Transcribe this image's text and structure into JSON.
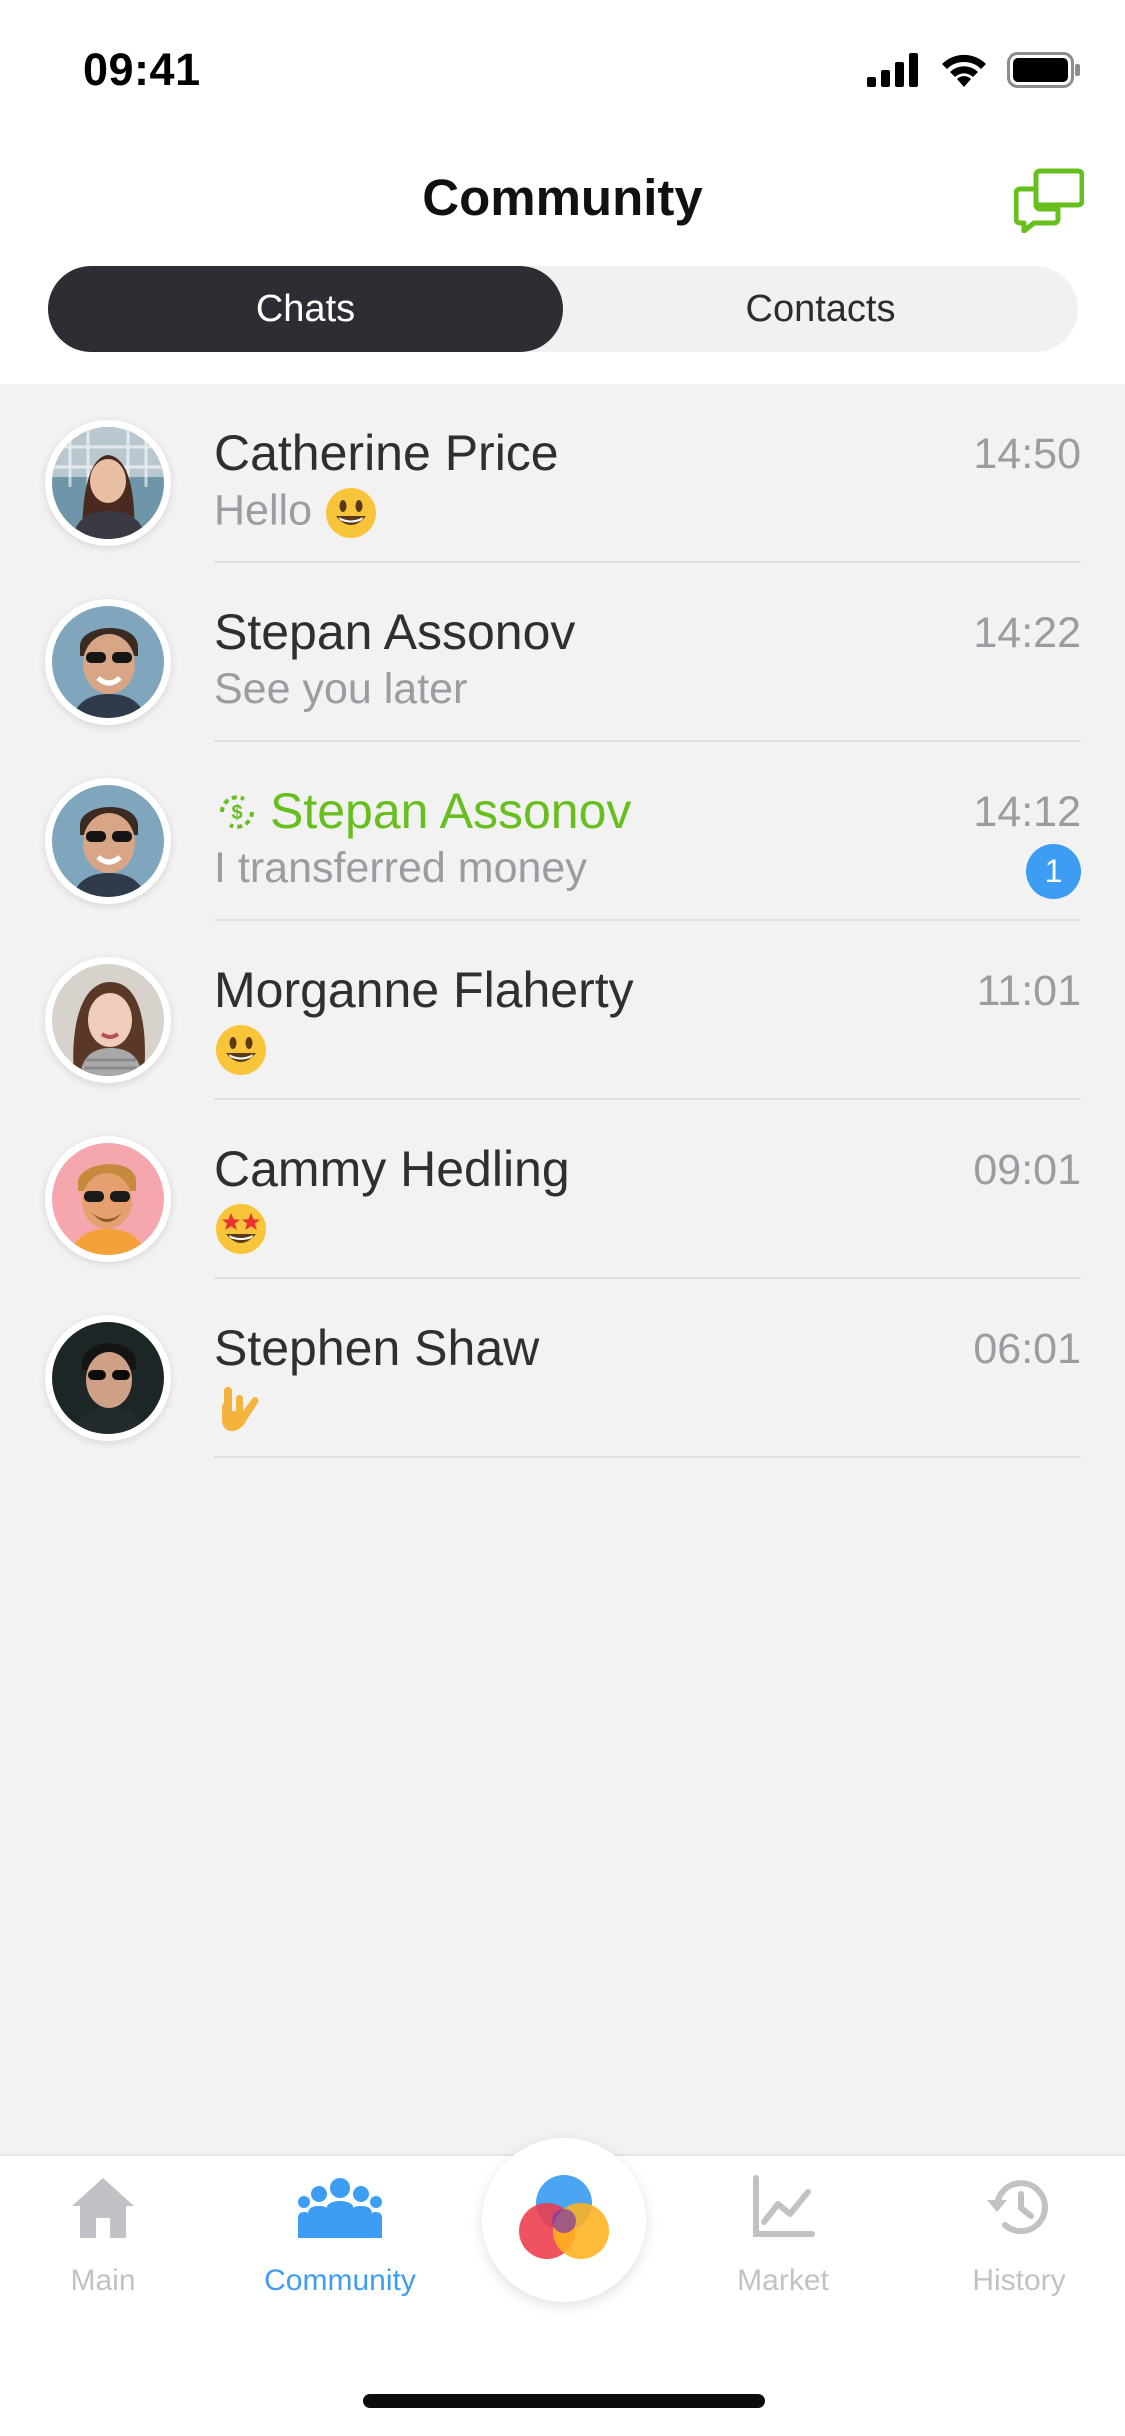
{
  "status_bar": {
    "time": "09:41"
  },
  "header": {
    "title": "Community"
  },
  "segments": {
    "chats": "Chats",
    "contacts": "Contacts"
  },
  "chats": [
    {
      "name": "Catherine Price",
      "preview": "Hello",
      "preview_emoji": "grinning-face",
      "time": "14:50"
    },
    {
      "name": "Stepan Assonov",
      "preview": "See you later",
      "time": "14:22"
    },
    {
      "name": "Stepan Assonov",
      "preview": "I transferred money",
      "time": "14:12",
      "unread": "1",
      "name_color": "#66bf1d",
      "name_icon": "money-transfer-icon"
    },
    {
      "name": "Morganne Flaherty",
      "preview": "",
      "preview_emoji": "grinning-face",
      "time": "11:01"
    },
    {
      "name": "Cammy Hedling",
      "preview": "",
      "preview_emoji": "star-struck-face",
      "time": "09:01"
    },
    {
      "name": "Stephen Shaw",
      "preview": "",
      "preview_emoji": "love-you-gesture",
      "time": "06:01"
    }
  ],
  "tab_bar": {
    "main": "Main",
    "community": "Community",
    "market": "Market",
    "history": "History"
  },
  "colors": {
    "accent_green": "#66bf1d",
    "accent_blue": "#3d9df2",
    "segment_active": "#2d2d33",
    "background": "#f2f2f3"
  }
}
